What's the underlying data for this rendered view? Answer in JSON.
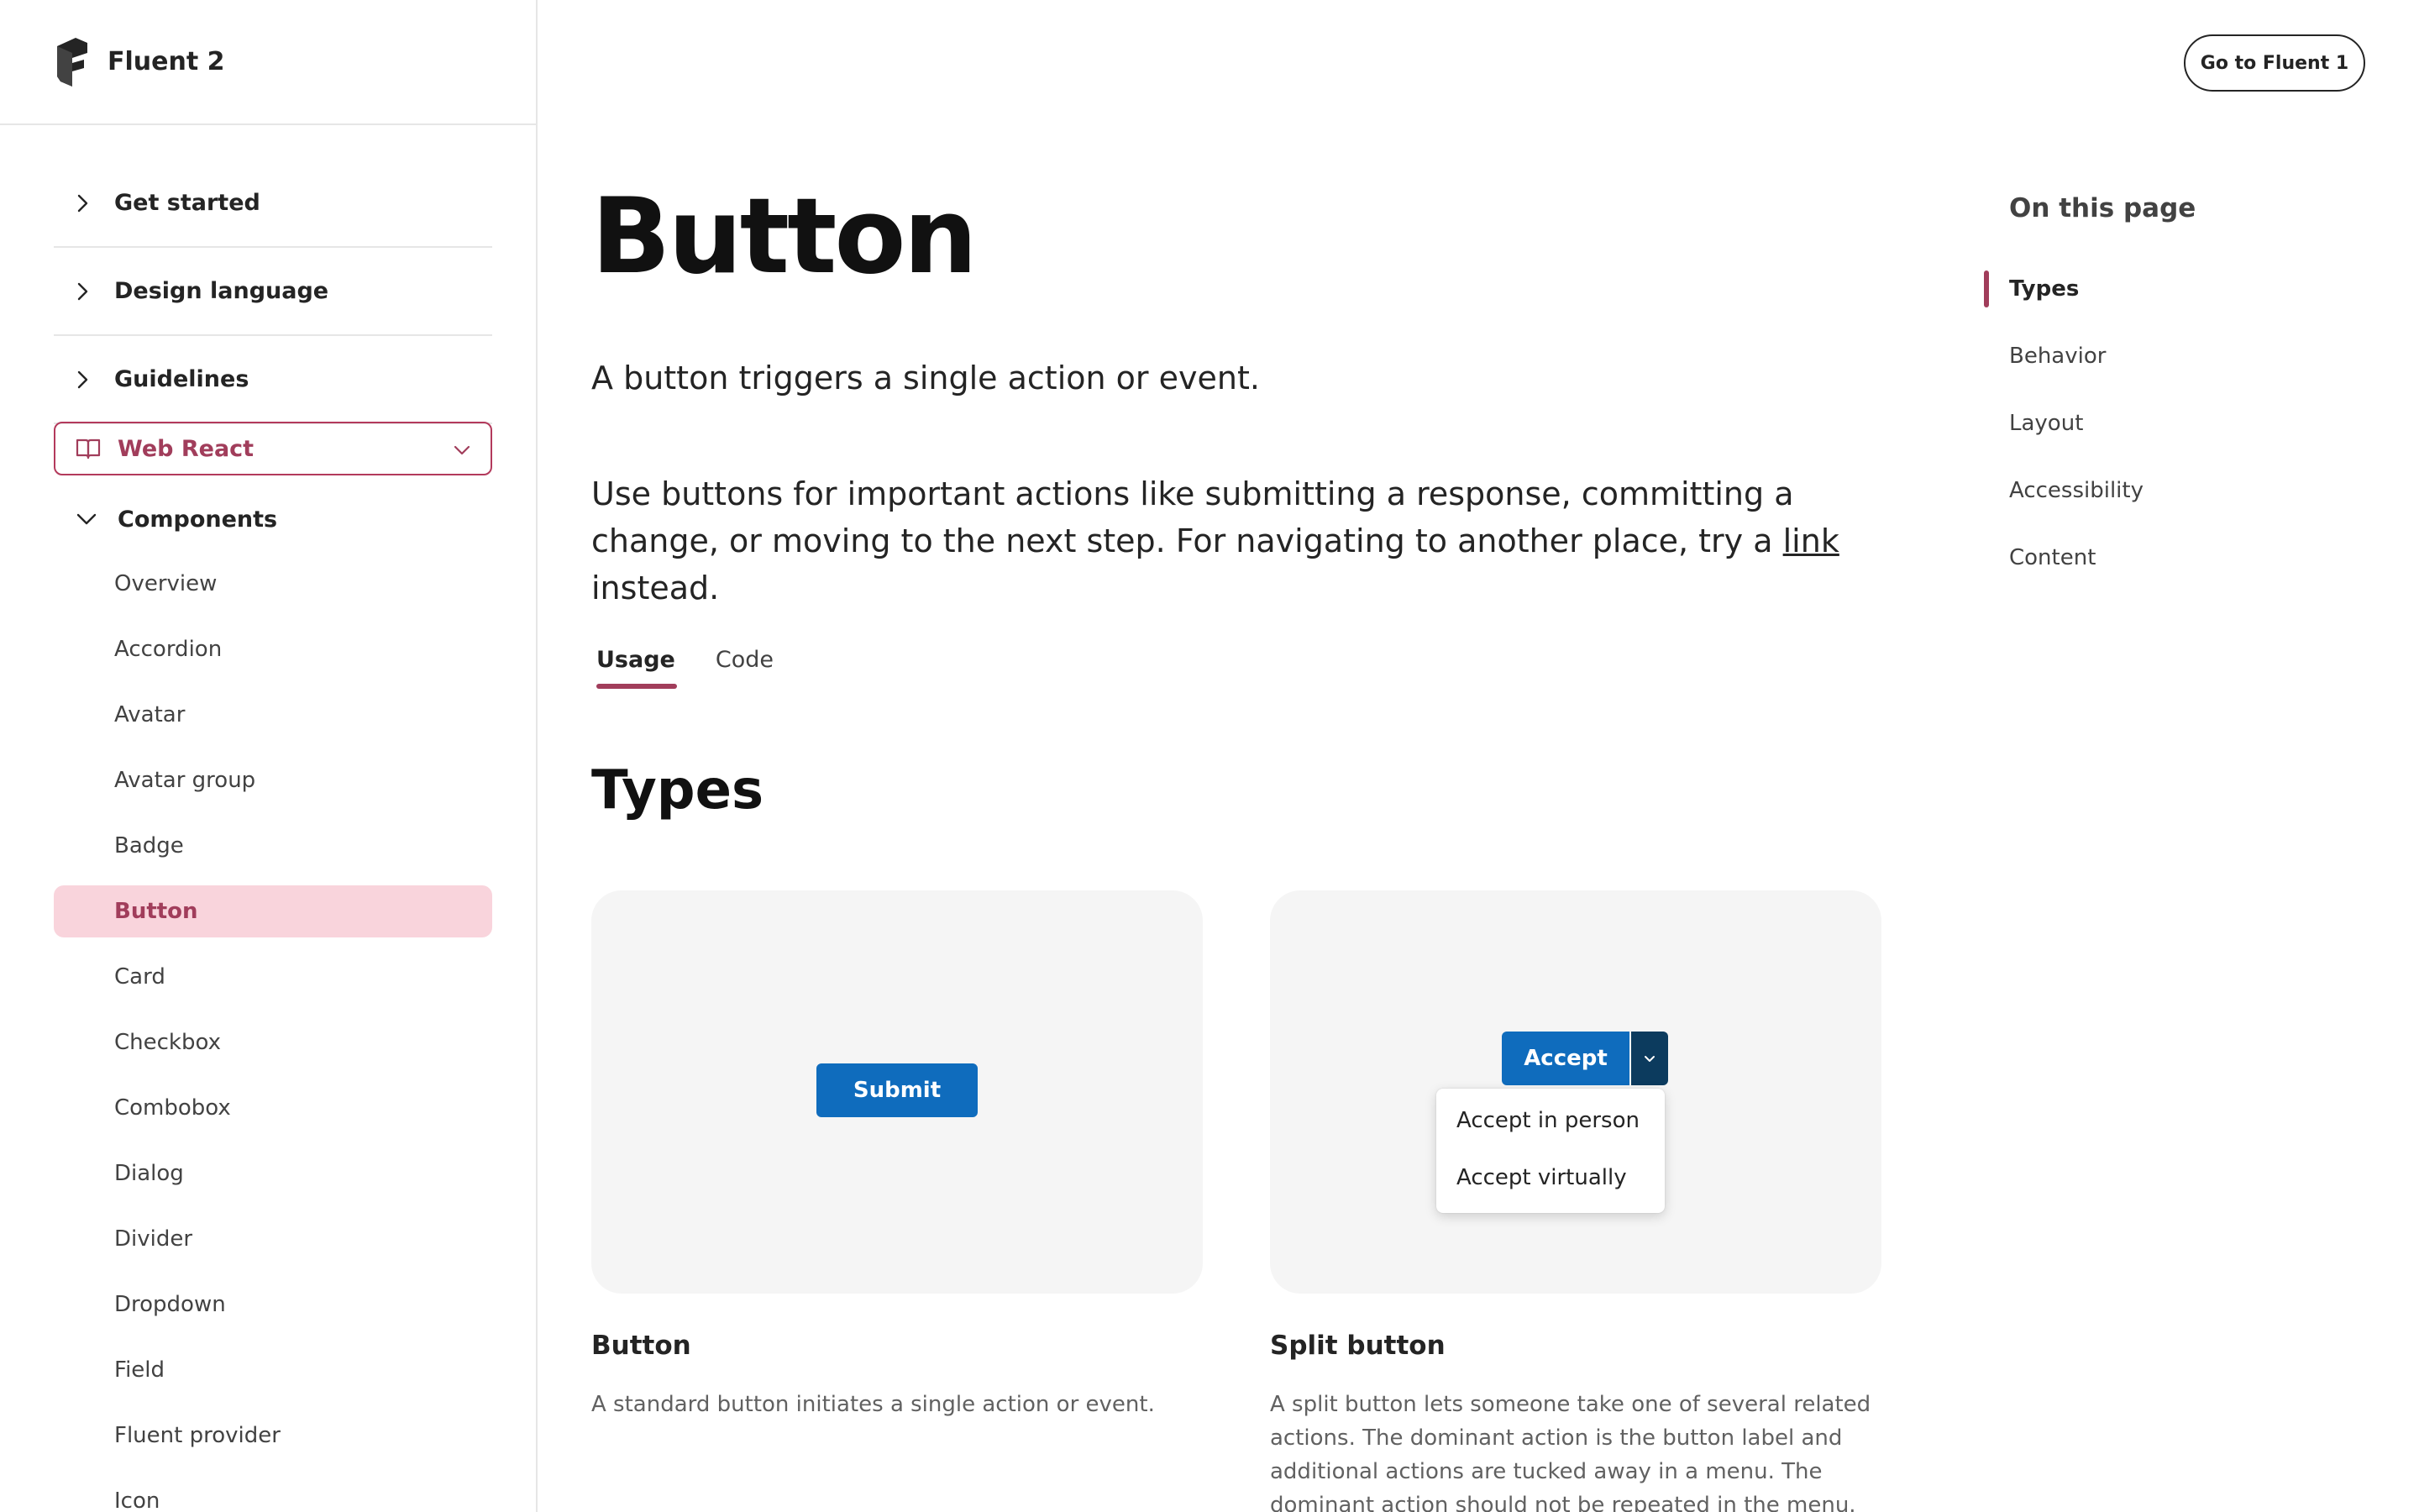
{
  "brand": {
    "name": "Fluent 2"
  },
  "header": {
    "go_fluent1_label": "Go to Fluent 1"
  },
  "sidebar": {
    "top_items": [
      {
        "label": "Get started"
      },
      {
        "label": "Design language"
      },
      {
        "label": "Guidelines"
      }
    ],
    "platform_selector": {
      "selected": "Web React"
    },
    "components_label": "Components",
    "components": [
      "Overview",
      "Accordion",
      "Avatar",
      "Avatar group",
      "Badge",
      "Button",
      "Card",
      "Checkbox",
      "Combobox",
      "Dialog",
      "Divider",
      "Dropdown",
      "Field",
      "Fluent provider",
      "Icon"
    ],
    "active_component": "Button"
  },
  "main": {
    "title": "Button",
    "lead": "A button triggers a single action or event.",
    "body_before_link": "Use buttons for important actions like submitting a response, committing a change, or moving to the next step. For navigating to another place, try a ",
    "body_link": "link",
    "body_after_link": " instead.",
    "tabs": [
      {
        "label": "Usage"
      },
      {
        "label": "Code"
      }
    ],
    "active_tab": "Usage",
    "section_title": "Types",
    "cards": [
      {
        "demo_button_label": "Submit",
        "title": "Button",
        "description": "A standard button initiates a single action or event."
      },
      {
        "demo_button_label": "Accept",
        "menu_items": [
          "Accept in person",
          "Accept virtually"
        ],
        "title": "Split button",
        "description": "A split button lets someone take one of several related actions. The dominant action is the button label and additional actions are tucked away in a menu. The dominant action should not be repeated in the menu."
      }
    ]
  },
  "toc": {
    "title": "On this page",
    "items": [
      "Types",
      "Behavior",
      "Layout",
      "Accessibility",
      "Content"
    ],
    "active": "Types"
  },
  "colors": {
    "accent": "#a13d5b",
    "accent_bg": "#f9d4dc",
    "brand_blue": "#0f6cbd",
    "brand_blue_dark": "#0c3b5e"
  }
}
